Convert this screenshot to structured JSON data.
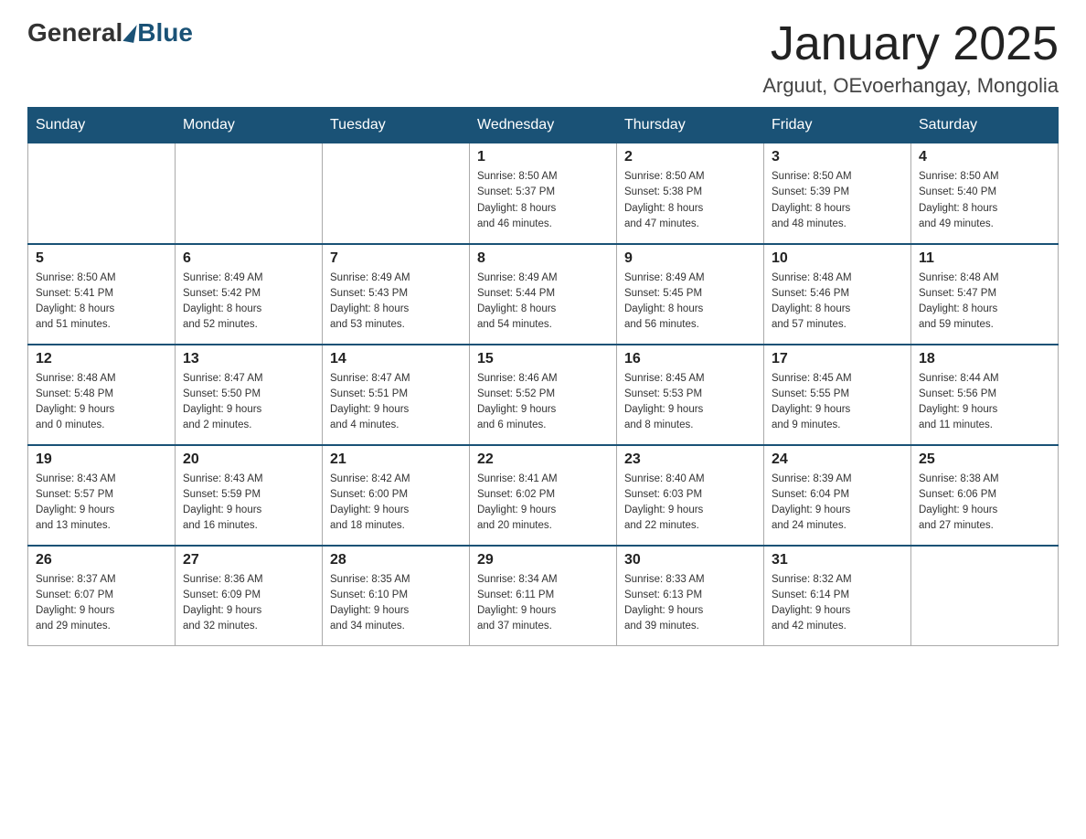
{
  "header": {
    "logo_general": "General",
    "logo_blue": "Blue",
    "month_title": "January 2025",
    "location": "Arguut, OEvoerhangay, Mongolia"
  },
  "days_of_week": [
    "Sunday",
    "Monday",
    "Tuesday",
    "Wednesday",
    "Thursday",
    "Friday",
    "Saturday"
  ],
  "weeks": [
    [
      {
        "day": "",
        "info": ""
      },
      {
        "day": "",
        "info": ""
      },
      {
        "day": "",
        "info": ""
      },
      {
        "day": "1",
        "info": "Sunrise: 8:50 AM\nSunset: 5:37 PM\nDaylight: 8 hours\nand 46 minutes."
      },
      {
        "day": "2",
        "info": "Sunrise: 8:50 AM\nSunset: 5:38 PM\nDaylight: 8 hours\nand 47 minutes."
      },
      {
        "day": "3",
        "info": "Sunrise: 8:50 AM\nSunset: 5:39 PM\nDaylight: 8 hours\nand 48 minutes."
      },
      {
        "day": "4",
        "info": "Sunrise: 8:50 AM\nSunset: 5:40 PM\nDaylight: 8 hours\nand 49 minutes."
      }
    ],
    [
      {
        "day": "5",
        "info": "Sunrise: 8:50 AM\nSunset: 5:41 PM\nDaylight: 8 hours\nand 51 minutes."
      },
      {
        "day": "6",
        "info": "Sunrise: 8:49 AM\nSunset: 5:42 PM\nDaylight: 8 hours\nand 52 minutes."
      },
      {
        "day": "7",
        "info": "Sunrise: 8:49 AM\nSunset: 5:43 PM\nDaylight: 8 hours\nand 53 minutes."
      },
      {
        "day": "8",
        "info": "Sunrise: 8:49 AM\nSunset: 5:44 PM\nDaylight: 8 hours\nand 54 minutes."
      },
      {
        "day": "9",
        "info": "Sunrise: 8:49 AM\nSunset: 5:45 PM\nDaylight: 8 hours\nand 56 minutes."
      },
      {
        "day": "10",
        "info": "Sunrise: 8:48 AM\nSunset: 5:46 PM\nDaylight: 8 hours\nand 57 minutes."
      },
      {
        "day": "11",
        "info": "Sunrise: 8:48 AM\nSunset: 5:47 PM\nDaylight: 8 hours\nand 59 minutes."
      }
    ],
    [
      {
        "day": "12",
        "info": "Sunrise: 8:48 AM\nSunset: 5:48 PM\nDaylight: 9 hours\nand 0 minutes."
      },
      {
        "day": "13",
        "info": "Sunrise: 8:47 AM\nSunset: 5:50 PM\nDaylight: 9 hours\nand 2 minutes."
      },
      {
        "day": "14",
        "info": "Sunrise: 8:47 AM\nSunset: 5:51 PM\nDaylight: 9 hours\nand 4 minutes."
      },
      {
        "day": "15",
        "info": "Sunrise: 8:46 AM\nSunset: 5:52 PM\nDaylight: 9 hours\nand 6 minutes."
      },
      {
        "day": "16",
        "info": "Sunrise: 8:45 AM\nSunset: 5:53 PM\nDaylight: 9 hours\nand 8 minutes."
      },
      {
        "day": "17",
        "info": "Sunrise: 8:45 AM\nSunset: 5:55 PM\nDaylight: 9 hours\nand 9 minutes."
      },
      {
        "day": "18",
        "info": "Sunrise: 8:44 AM\nSunset: 5:56 PM\nDaylight: 9 hours\nand 11 minutes."
      }
    ],
    [
      {
        "day": "19",
        "info": "Sunrise: 8:43 AM\nSunset: 5:57 PM\nDaylight: 9 hours\nand 13 minutes."
      },
      {
        "day": "20",
        "info": "Sunrise: 8:43 AM\nSunset: 5:59 PM\nDaylight: 9 hours\nand 16 minutes."
      },
      {
        "day": "21",
        "info": "Sunrise: 8:42 AM\nSunset: 6:00 PM\nDaylight: 9 hours\nand 18 minutes."
      },
      {
        "day": "22",
        "info": "Sunrise: 8:41 AM\nSunset: 6:02 PM\nDaylight: 9 hours\nand 20 minutes."
      },
      {
        "day": "23",
        "info": "Sunrise: 8:40 AM\nSunset: 6:03 PM\nDaylight: 9 hours\nand 22 minutes."
      },
      {
        "day": "24",
        "info": "Sunrise: 8:39 AM\nSunset: 6:04 PM\nDaylight: 9 hours\nand 24 minutes."
      },
      {
        "day": "25",
        "info": "Sunrise: 8:38 AM\nSunset: 6:06 PM\nDaylight: 9 hours\nand 27 minutes."
      }
    ],
    [
      {
        "day": "26",
        "info": "Sunrise: 8:37 AM\nSunset: 6:07 PM\nDaylight: 9 hours\nand 29 minutes."
      },
      {
        "day": "27",
        "info": "Sunrise: 8:36 AM\nSunset: 6:09 PM\nDaylight: 9 hours\nand 32 minutes."
      },
      {
        "day": "28",
        "info": "Sunrise: 8:35 AM\nSunset: 6:10 PM\nDaylight: 9 hours\nand 34 minutes."
      },
      {
        "day": "29",
        "info": "Sunrise: 8:34 AM\nSunset: 6:11 PM\nDaylight: 9 hours\nand 37 minutes."
      },
      {
        "day": "30",
        "info": "Sunrise: 8:33 AM\nSunset: 6:13 PM\nDaylight: 9 hours\nand 39 minutes."
      },
      {
        "day": "31",
        "info": "Sunrise: 8:32 AM\nSunset: 6:14 PM\nDaylight: 9 hours\nand 42 minutes."
      },
      {
        "day": "",
        "info": ""
      }
    ]
  ]
}
